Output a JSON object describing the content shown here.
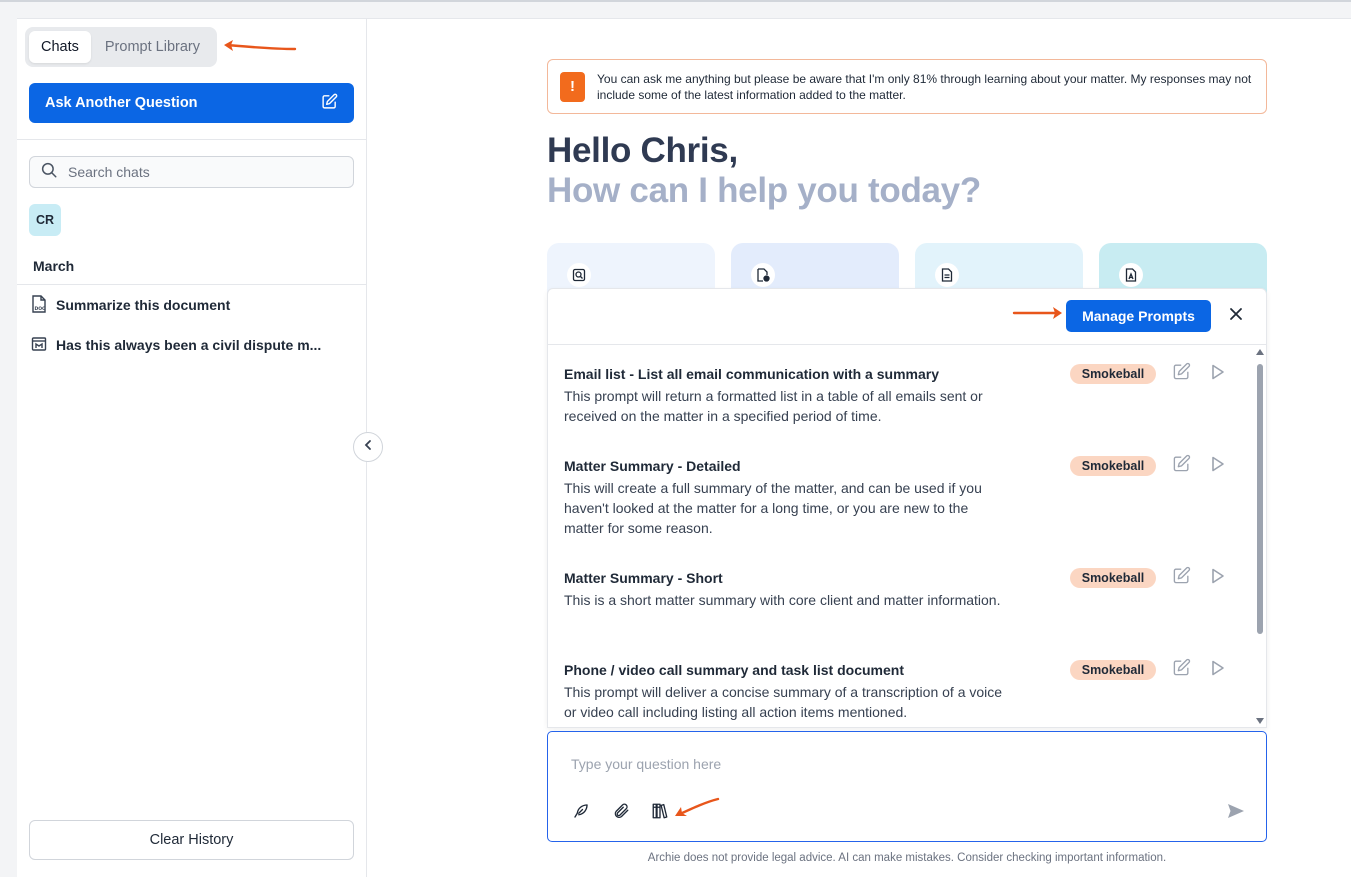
{
  "sidebar": {
    "tabs": [
      {
        "label": "Chats",
        "active": true
      },
      {
        "label": "Prompt Library",
        "active": false
      }
    ],
    "ask_button": "Ask Another Question",
    "search_placeholder": "Search chats",
    "avatar_initials": "CR",
    "section_label": "March",
    "chats": [
      {
        "title": "Summarize this document",
        "icon": "doc-file-icon"
      },
      {
        "title": "Has this always been a civil dispute m...",
        "icon": "matter-icon"
      }
    ],
    "clear_button": "Clear History"
  },
  "main": {
    "notice": "You can ask me anything but please be aware that I'm only 81% through learning about your matter. My responses may not include some of the latest information added to the matter.",
    "greeting": "Hello Chris,",
    "subgreeting": "How can I help you today?",
    "cards": [
      {
        "icon": "search-document-icon",
        "color": "#eef4fd"
      },
      {
        "icon": "document-clock-icon",
        "color": "#e3ecfc"
      },
      {
        "icon": "document-lines-icon",
        "color": "#e2f3fb"
      },
      {
        "icon": "pdf-document-icon",
        "color": "#c8ecf2"
      }
    ]
  },
  "prompt_panel": {
    "manage_button": "Manage Prompts",
    "prompts": [
      {
        "title": "Email list - List all email communication with a summary",
        "description": "This prompt will return a formatted list in a table of all emails sent or received on the matter in a specified period of time.",
        "badge": "Smokeball"
      },
      {
        "title": "Matter Summary - Detailed",
        "description": "This will create a full summary of the matter, and can be used if you haven't looked at the matter for a long time, or you are new to the matter for some reason.",
        "badge": "Smokeball"
      },
      {
        "title": "Matter Summary - Short",
        "description": "This is a short matter summary with core client and matter information.",
        "badge": "Smokeball"
      },
      {
        "title": "Phone / video call summary and task list document",
        "description": "This prompt will deliver a concise summary of a transcription of a voice or video call including listing all action items mentioned.",
        "badge": "Smokeball"
      }
    ]
  },
  "composer": {
    "placeholder": "Type your question here"
  },
  "disclaimer": "Archie does not provide legal advice. AI can make mistakes. Consider checking important information.",
  "colors": {
    "accent": "#0b66e4",
    "badge": "#fbd6c2",
    "notice_border": "#f3b89a",
    "annotation_arrow": "#e8561b"
  }
}
